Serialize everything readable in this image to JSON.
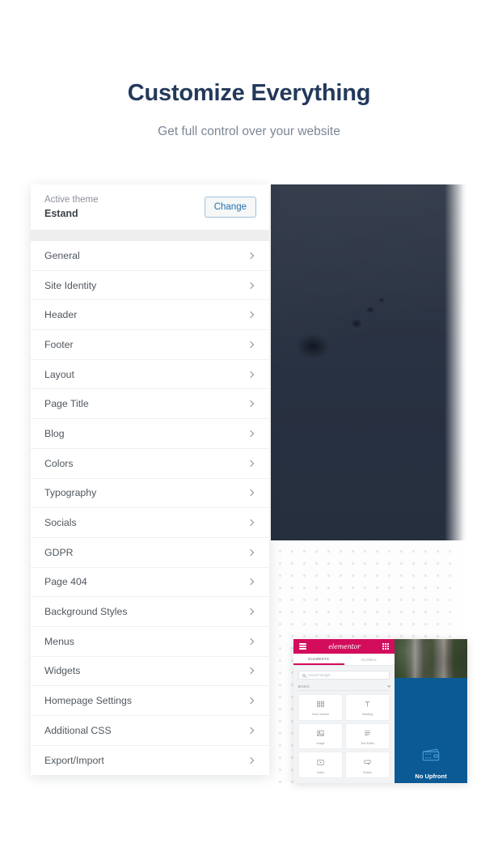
{
  "heading": {
    "title": "Customize Everything",
    "subtitle": "Get full control over your website"
  },
  "colors": {
    "title": "#23395b",
    "subtitle": "#7b8794",
    "accent_blue": "#2271b1",
    "elementor_pink": "#d30c5c",
    "preview_blue": "#0c5a94",
    "hero_dark": "#2a3342",
    "dot_gray": "#e7e8ea"
  },
  "customizer": {
    "theme_label": "Active theme",
    "theme_name": "Estand",
    "change_button": "Change",
    "items": [
      {
        "label": "General"
      },
      {
        "label": "Site Identity"
      },
      {
        "label": "Header"
      },
      {
        "label": "Footer"
      },
      {
        "label": "Layout"
      },
      {
        "label": "Page Title"
      },
      {
        "label": "Blog"
      },
      {
        "label": "Colors"
      },
      {
        "label": "Typography"
      },
      {
        "label": "Socials"
      },
      {
        "label": "GDPR"
      },
      {
        "label": "Page 404"
      },
      {
        "label": "Background Styles"
      },
      {
        "label": "Menus"
      },
      {
        "label": "Widgets"
      },
      {
        "label": "Homepage Settings"
      },
      {
        "label": "Additional CSS"
      },
      {
        "label": "Export/Import"
      }
    ]
  },
  "elementor": {
    "logo": "elementor",
    "tabs": [
      {
        "label": "ELEMENTS",
        "active": true
      },
      {
        "label": "GLOBAL",
        "active": false
      }
    ],
    "search_placeholder": "Search Widget...",
    "section_label": "BASIC",
    "widgets": [
      {
        "label": "Inner Section",
        "icon": "inner-section-icon"
      },
      {
        "label": "Heading",
        "icon": "heading-icon"
      },
      {
        "label": "Image",
        "icon": "image-icon"
      },
      {
        "label": "Text Editor",
        "icon": "text-editor-icon"
      },
      {
        "label": "Video",
        "icon": "video-icon"
      },
      {
        "label": "Button",
        "icon": "button-icon"
      }
    ],
    "preview_text": "No Upfront"
  }
}
